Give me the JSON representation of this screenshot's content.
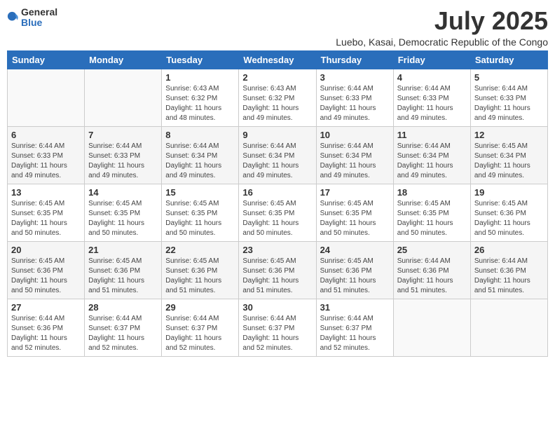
{
  "header": {
    "logo_general": "General",
    "logo_blue": "Blue",
    "month_year": "July 2025",
    "location": "Luebo, Kasai, Democratic Republic of the Congo"
  },
  "days_of_week": [
    "Sunday",
    "Monday",
    "Tuesday",
    "Wednesday",
    "Thursday",
    "Friday",
    "Saturday"
  ],
  "weeks": [
    [
      {
        "day": "",
        "info": ""
      },
      {
        "day": "",
        "info": ""
      },
      {
        "day": "1",
        "info": "Sunrise: 6:43 AM\nSunset: 6:32 PM\nDaylight: 11 hours and 48 minutes."
      },
      {
        "day": "2",
        "info": "Sunrise: 6:43 AM\nSunset: 6:32 PM\nDaylight: 11 hours and 49 minutes."
      },
      {
        "day": "3",
        "info": "Sunrise: 6:44 AM\nSunset: 6:33 PM\nDaylight: 11 hours and 49 minutes."
      },
      {
        "day": "4",
        "info": "Sunrise: 6:44 AM\nSunset: 6:33 PM\nDaylight: 11 hours and 49 minutes."
      },
      {
        "day": "5",
        "info": "Sunrise: 6:44 AM\nSunset: 6:33 PM\nDaylight: 11 hours and 49 minutes."
      }
    ],
    [
      {
        "day": "6",
        "info": "Sunrise: 6:44 AM\nSunset: 6:33 PM\nDaylight: 11 hours and 49 minutes."
      },
      {
        "day": "7",
        "info": "Sunrise: 6:44 AM\nSunset: 6:33 PM\nDaylight: 11 hours and 49 minutes."
      },
      {
        "day": "8",
        "info": "Sunrise: 6:44 AM\nSunset: 6:34 PM\nDaylight: 11 hours and 49 minutes."
      },
      {
        "day": "9",
        "info": "Sunrise: 6:44 AM\nSunset: 6:34 PM\nDaylight: 11 hours and 49 minutes."
      },
      {
        "day": "10",
        "info": "Sunrise: 6:44 AM\nSunset: 6:34 PM\nDaylight: 11 hours and 49 minutes."
      },
      {
        "day": "11",
        "info": "Sunrise: 6:44 AM\nSunset: 6:34 PM\nDaylight: 11 hours and 49 minutes."
      },
      {
        "day": "12",
        "info": "Sunrise: 6:45 AM\nSunset: 6:34 PM\nDaylight: 11 hours and 49 minutes."
      }
    ],
    [
      {
        "day": "13",
        "info": "Sunrise: 6:45 AM\nSunset: 6:35 PM\nDaylight: 11 hours and 50 minutes."
      },
      {
        "day": "14",
        "info": "Sunrise: 6:45 AM\nSunset: 6:35 PM\nDaylight: 11 hours and 50 minutes."
      },
      {
        "day": "15",
        "info": "Sunrise: 6:45 AM\nSunset: 6:35 PM\nDaylight: 11 hours and 50 minutes."
      },
      {
        "day": "16",
        "info": "Sunrise: 6:45 AM\nSunset: 6:35 PM\nDaylight: 11 hours and 50 minutes."
      },
      {
        "day": "17",
        "info": "Sunrise: 6:45 AM\nSunset: 6:35 PM\nDaylight: 11 hours and 50 minutes."
      },
      {
        "day": "18",
        "info": "Sunrise: 6:45 AM\nSunset: 6:35 PM\nDaylight: 11 hours and 50 minutes."
      },
      {
        "day": "19",
        "info": "Sunrise: 6:45 AM\nSunset: 6:36 PM\nDaylight: 11 hours and 50 minutes."
      }
    ],
    [
      {
        "day": "20",
        "info": "Sunrise: 6:45 AM\nSunset: 6:36 PM\nDaylight: 11 hours and 50 minutes."
      },
      {
        "day": "21",
        "info": "Sunrise: 6:45 AM\nSunset: 6:36 PM\nDaylight: 11 hours and 51 minutes."
      },
      {
        "day": "22",
        "info": "Sunrise: 6:45 AM\nSunset: 6:36 PM\nDaylight: 11 hours and 51 minutes."
      },
      {
        "day": "23",
        "info": "Sunrise: 6:45 AM\nSunset: 6:36 PM\nDaylight: 11 hours and 51 minutes."
      },
      {
        "day": "24",
        "info": "Sunrise: 6:45 AM\nSunset: 6:36 PM\nDaylight: 11 hours and 51 minutes."
      },
      {
        "day": "25",
        "info": "Sunrise: 6:44 AM\nSunset: 6:36 PM\nDaylight: 11 hours and 51 minutes."
      },
      {
        "day": "26",
        "info": "Sunrise: 6:44 AM\nSunset: 6:36 PM\nDaylight: 11 hours and 51 minutes."
      }
    ],
    [
      {
        "day": "27",
        "info": "Sunrise: 6:44 AM\nSunset: 6:36 PM\nDaylight: 11 hours and 52 minutes."
      },
      {
        "day": "28",
        "info": "Sunrise: 6:44 AM\nSunset: 6:37 PM\nDaylight: 11 hours and 52 minutes."
      },
      {
        "day": "29",
        "info": "Sunrise: 6:44 AM\nSunset: 6:37 PM\nDaylight: 11 hours and 52 minutes."
      },
      {
        "day": "30",
        "info": "Sunrise: 6:44 AM\nSunset: 6:37 PM\nDaylight: 11 hours and 52 minutes."
      },
      {
        "day": "31",
        "info": "Sunrise: 6:44 AM\nSunset: 6:37 PM\nDaylight: 11 hours and 52 minutes."
      },
      {
        "day": "",
        "info": ""
      },
      {
        "day": "",
        "info": ""
      }
    ]
  ]
}
